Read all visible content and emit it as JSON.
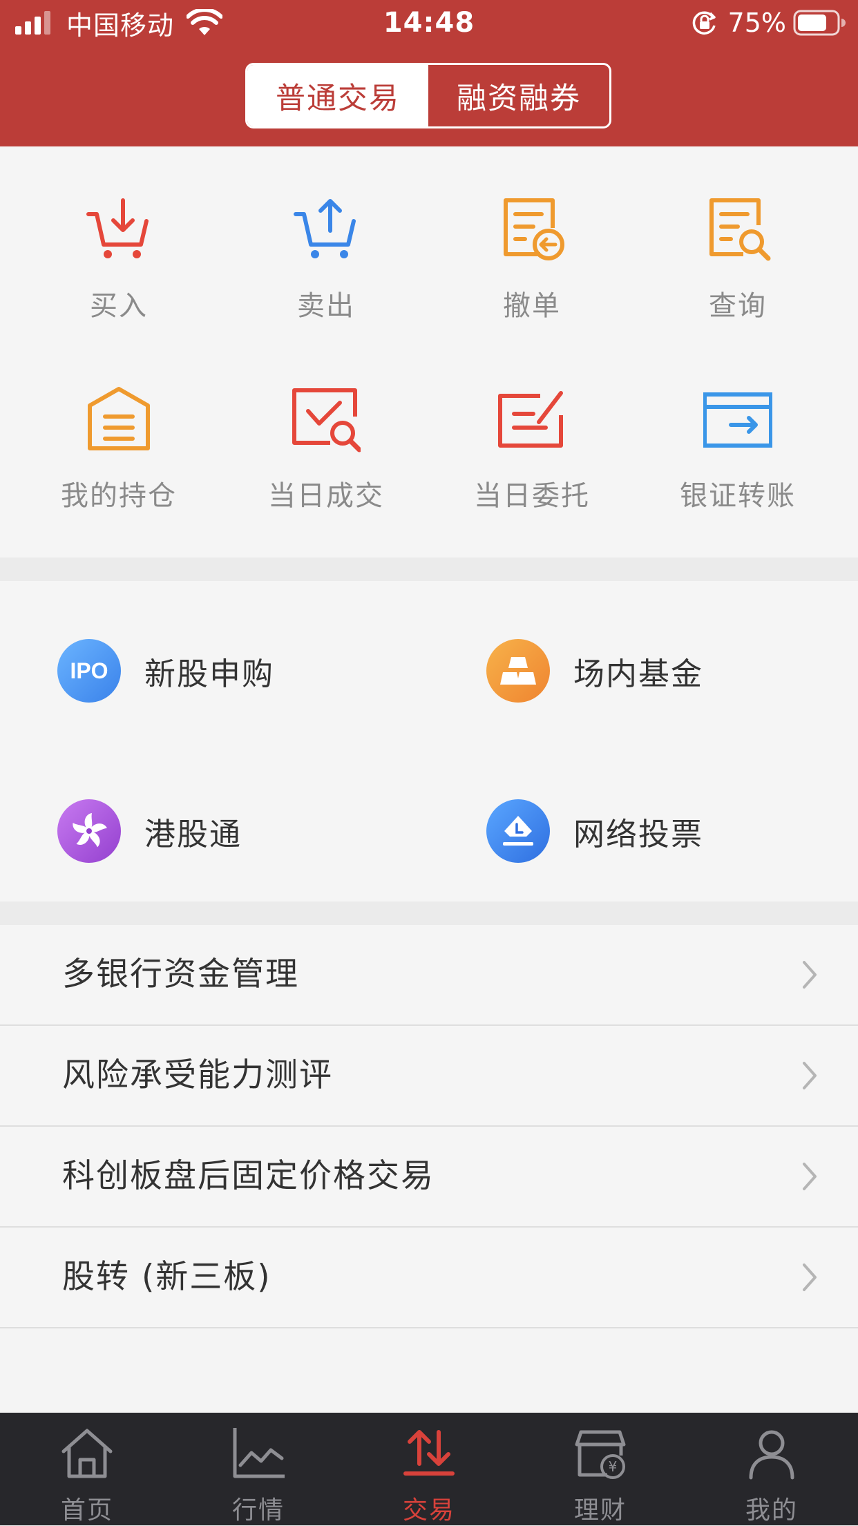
{
  "status_bar": {
    "carrier": "中国移动",
    "time": "14:48",
    "battery": "75%",
    "battery_level": 0.75,
    "icons": [
      "signal-icon",
      "wifi-icon",
      "orientation-lock-icon",
      "battery-icon"
    ]
  },
  "header": {
    "segments": [
      {
        "label": "普通交易",
        "active": true
      },
      {
        "label": "融资融券",
        "active": false
      }
    ]
  },
  "quick_actions": [
    {
      "label": "买入",
      "icon": "cart-in-icon",
      "color": "#e5473a"
    },
    {
      "label": "卖出",
      "icon": "cart-out-icon",
      "color": "#3a86e8"
    },
    {
      "label": "撤单",
      "icon": "doc-revoke-icon",
      "color": "#ef9a2e"
    },
    {
      "label": "查询",
      "icon": "doc-search-icon",
      "color": "#ef9a2e"
    },
    {
      "label": "我的持仓",
      "icon": "house-holdings-icon",
      "color": "#ef9a2e"
    },
    {
      "label": "当日成交",
      "icon": "deal-search-icon",
      "color": "#e5473a"
    },
    {
      "label": "当日委托",
      "icon": "entrust-edit-icon",
      "color": "#e5473a"
    },
    {
      "label": "银证转账",
      "icon": "card-transfer-icon",
      "color": "#3a96e8"
    }
  ],
  "services": [
    {
      "label": "新股申购",
      "icon": "ipo-icon",
      "badge": "IPO",
      "color": "#4a98f0"
    },
    {
      "label": "场内基金",
      "icon": "gold-bars-icon",
      "color": "#f29a3a"
    },
    {
      "label": "港股通",
      "icon": "bauhinia-icon",
      "color": "#a752d8"
    },
    {
      "label": "网络投票",
      "icon": "ballot-box-icon",
      "color": "#3a7fe6"
    }
  ],
  "list_items": [
    {
      "label": "多银行资金管理"
    },
    {
      "label": "风险承受能力测评"
    },
    {
      "label": "科创板盘后固定价格交易"
    },
    {
      "label": "股转 (新三板)"
    }
  ],
  "tab_bar": {
    "items": [
      {
        "label": "首页",
        "icon": "home-icon",
        "active": false
      },
      {
        "label": "行情",
        "icon": "chart-icon",
        "active": false
      },
      {
        "label": "交易",
        "icon": "trade-arrows-icon",
        "active": true
      },
      {
        "label": "理财",
        "icon": "wallet-shop-icon",
        "active": false
      },
      {
        "label": "我的",
        "icon": "user-icon",
        "active": false
      }
    ],
    "active_color": "#d8423b"
  },
  "theme": {
    "primary": "#bb3d38"
  }
}
